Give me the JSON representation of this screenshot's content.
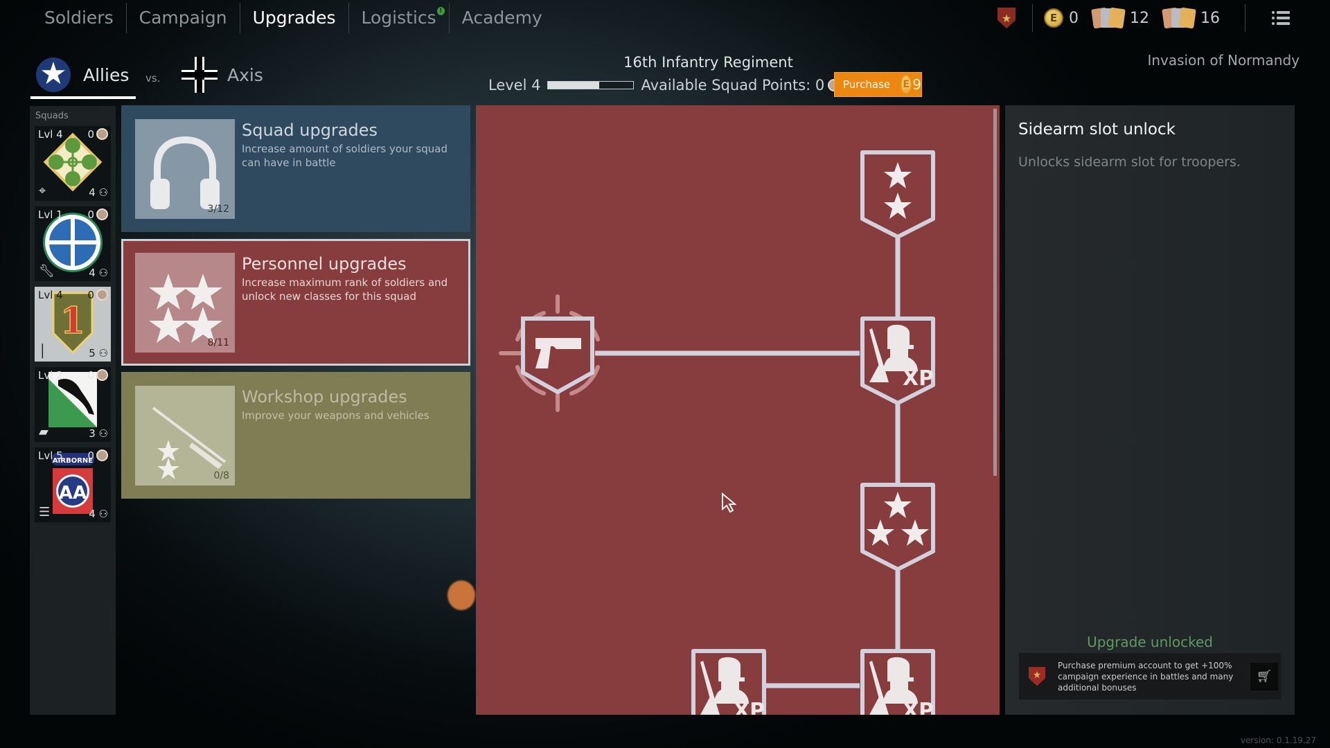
{
  "nav": {
    "tabs": [
      {
        "label": "Soldiers",
        "active": false
      },
      {
        "label": "Campaign",
        "active": false
      },
      {
        "label": "Upgrades",
        "active": true
      },
      {
        "label": "Logistics",
        "active": false,
        "badge": "!"
      },
      {
        "label": "Academy",
        "active": false
      }
    ]
  },
  "resources": {
    "premium_icon": "premium-shield-icon",
    "gold": "0",
    "weapon_orders": "12",
    "soldier_orders": "16",
    "menu_icon": "list-icon"
  },
  "factions": {
    "allies": "Allies",
    "vs": "vs.",
    "axis": "Axis",
    "selected": "Allies"
  },
  "regiment": {
    "name": "16th Infantry Regiment",
    "level_label": "Level 4",
    "level_progress": 0.6,
    "squad_points_label": "Available Squad Points: 0",
    "purchase_label": "Purchase",
    "purchase_price": "9"
  },
  "campaign": "Invasion of Normandy",
  "sidebar": {
    "title": "Squads",
    "squads": [
      {
        "level": "Lvl 4",
        "points": "0",
        "count": "4",
        "type_icon": "crosshair-icon",
        "emblem": "4th-infantry-ivy-emblem",
        "selected": false
      },
      {
        "level": "Lvl 1",
        "points": "0",
        "count": "4",
        "type_icon": "wrench-icon",
        "emblem": "blue-cross-circle-emblem",
        "selected": false
      },
      {
        "level": "Lvl 4",
        "points": "0",
        "count": "5",
        "type_icon": "bullet-icon",
        "emblem": "big-red-one-emblem",
        "selected": true
      },
      {
        "level": "Lvl 2",
        "points": "0",
        "count": "3",
        "type_icon": "tank-icon",
        "emblem": "panther-emblem",
        "selected": false
      },
      {
        "level": "Lvl 5",
        "points": "0",
        "count": "4",
        "type_icon": "list-icon",
        "emblem": "airborne-aa-emblem",
        "selected": false,
        "emblem_text": "AIRBORNE"
      }
    ]
  },
  "categories": [
    {
      "title": "Squad upgrades",
      "desc": "Increase amount of soldiers your squad can have in battle",
      "count": "3/12",
      "icon": "headphones-icon"
    },
    {
      "title": "Personnel upgrades",
      "desc": "Increase maximum rank of soldiers and unlock new classes for this squad",
      "count": "8/11",
      "icon": "four-stars-icon",
      "selected": true
    },
    {
      "title": "Workshop upgrades",
      "desc": "Improve your weapons and vehicles",
      "count": "0/8",
      "icon": "rifle-stars-icon"
    }
  ],
  "tree": {
    "nodes": [
      {
        "id": "sidearm",
        "icon": "pistol-icon",
        "selected": true
      },
      {
        "id": "rank-2",
        "icon": "two-stars-icon"
      },
      {
        "id": "xp-1",
        "icon": "soldier-xp-icon",
        "label": "XP"
      },
      {
        "id": "rank-3",
        "icon": "three-stars-icon"
      },
      {
        "id": "xp-2",
        "icon": "soldier-xp-icon",
        "label": "XP"
      },
      {
        "id": "xp-3",
        "icon": "soldier-xp-icon",
        "label": "XP"
      }
    ]
  },
  "details": {
    "title": "Sidearm slot unlock",
    "desc": "Unlocks sidearm slot for troopers.",
    "status": "Upgrade unlocked",
    "promo": "Purchase premium account to get +100% campaign experience in battles and many additional bonuses",
    "colors": {
      "status": "#5e9a62"
    }
  },
  "version": "version: 0.1.19.27",
  "colors": {
    "personnel": "#873c3d",
    "squad": "#2f4a5e",
    "workshop": "#7e7d54",
    "purchase": "#ec8712"
  }
}
